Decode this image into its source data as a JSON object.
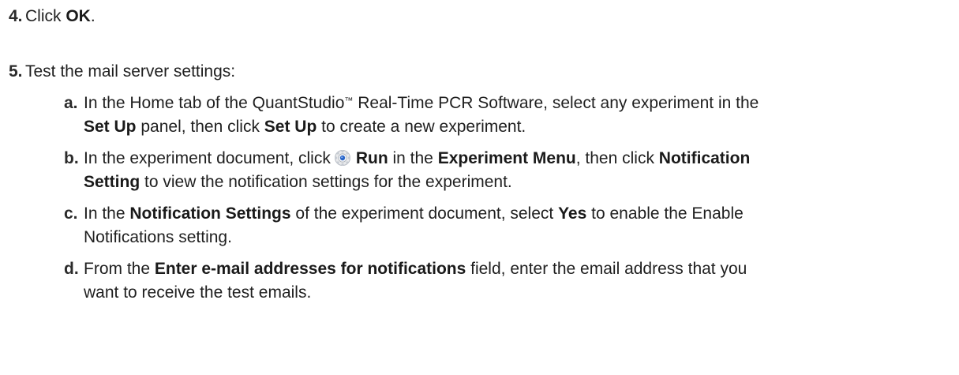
{
  "steps": [
    {
      "number": "4.",
      "text_pre": "Click ",
      "text_bold": "OK",
      "text_post": "."
    },
    {
      "number": "5.",
      "text": "Test the mail server settings:"
    }
  ],
  "substeps": {
    "a": {
      "letter": "a.",
      "l1_t1": "In the Home tab of the QuantStudio",
      "l1_tm": "™",
      "l1_t2": " Real-Time PCR Software, select any experiment in the",
      "l2_b1": "Set Up",
      "l2_t1": " panel, then click ",
      "l2_b2": "Set Up",
      "l2_t2": " to create a new experiment."
    },
    "b": {
      "letter": "b.",
      "l1_t1": "In the experiment document, click",
      "l1_b1": "Run",
      "l1_t2": " in the ",
      "l1_b2": "Experiment Menu",
      "l1_t3": ", then click ",
      "l1_b3": "Notification",
      "l2_b1": "Setting",
      "l2_t1": " to view the notification settings for the experiment.",
      "icon": "run-gear-icon"
    },
    "c": {
      "letter": "c.",
      "l1_t1": "In the ",
      "l1_b1": "Notification Settings",
      "l1_t2": " of the experiment document, select ",
      "l1_b2": "Yes",
      "l1_t3": " to enable the Enable",
      "l2_t1": "Notifications setting."
    },
    "d": {
      "letter": "d.",
      "l1_t1": "From the ",
      "l1_b1": "Enter e-mail addresses for notifications",
      "l1_t2": " field, enter the email address that you",
      "l2_t1": "want to receive the test emails."
    }
  },
  "colors": {
    "text": "#1f1f1f",
    "icon_blue": "#2a66c9"
  }
}
